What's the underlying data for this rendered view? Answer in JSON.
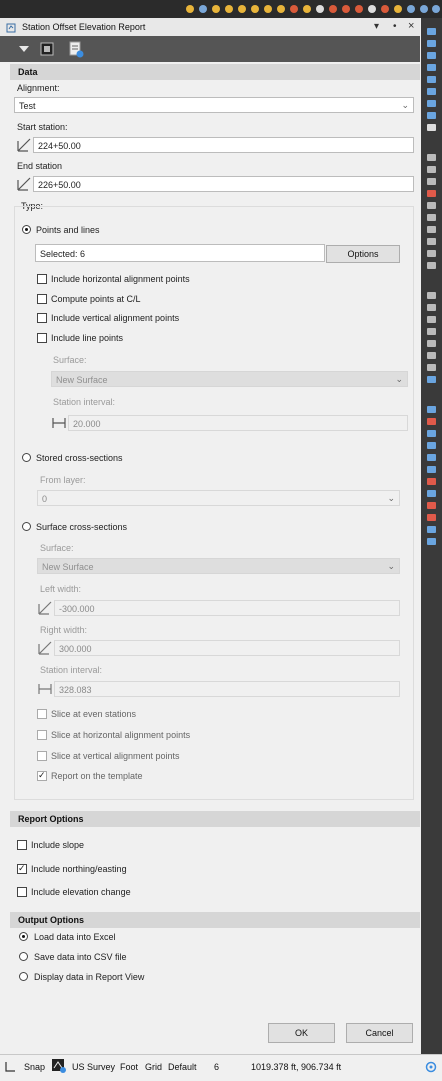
{
  "window": {
    "title": "Station Offset Elevation Report"
  },
  "data_section": {
    "header": "Data",
    "alignment_label": "Alignment:",
    "alignment_value": "Test",
    "start_station_label": "Start station:",
    "start_station_value": "224+50.00",
    "end_station_label": "End station",
    "end_station_value": "226+50.00",
    "type_label": "Type:"
  },
  "points_and_lines": {
    "label": "Points and lines",
    "selected": true,
    "selected_text": "Selected: 6",
    "options_button": "Options",
    "checkboxes": [
      {
        "label": "Include horizontal alignment points",
        "checked": false
      },
      {
        "label": "Compute points at C/L",
        "checked": false
      },
      {
        "label": "Include vertical alignment points",
        "checked": false
      },
      {
        "label": "Include line points",
        "checked": false
      }
    ],
    "surface_label": "Surface:",
    "surface_value": "New Surface",
    "station_interval_label": "Station interval:",
    "station_interval_value": "20.000"
  },
  "stored_cross_sections": {
    "label": "Stored cross-sections",
    "selected": false,
    "from_layer_label": "From layer:",
    "from_layer_value": "0"
  },
  "surface_cross_sections": {
    "label": "Surface cross-sections",
    "selected": false,
    "surface_label": "Surface:",
    "surface_value": "New Surface",
    "left_width_label": "Left width:",
    "left_width_value": "-300.000",
    "right_width_label": "Right width:",
    "right_width_value": "300.000",
    "station_interval_label": "Station interval:",
    "station_interval_value": "328.083",
    "checkboxes": [
      {
        "label": "Slice at even stations",
        "checked": false
      },
      {
        "label": "Slice at horizontal alignment points",
        "checked": false
      },
      {
        "label": "Slice at vertical alignment points",
        "checked": false
      },
      {
        "label": "Report on the template",
        "checked": true
      }
    ]
  },
  "report_options": {
    "header": "Report Options",
    "checkboxes": [
      {
        "label": "Include slope",
        "checked": false
      },
      {
        "label": "Include northing/easting",
        "checked": true
      },
      {
        "label": "Include elevation change",
        "checked": false
      }
    ]
  },
  "output_options": {
    "header": "Output Options",
    "radios": [
      {
        "label": "Load data into Excel",
        "selected": true
      },
      {
        "label": "Save data into CSV file",
        "selected": false
      },
      {
        "label": "Display data in Report View",
        "selected": false
      }
    ]
  },
  "buttons": {
    "ok": "OK",
    "cancel": "Cancel"
  },
  "statusbar": {
    "snap": "Snap",
    "units": "US Survey",
    "unit": "Foot",
    "grid": "Grid",
    "layer": "Default",
    "count": "6",
    "coords": "1019.378 ft, 906.734 ft"
  }
}
